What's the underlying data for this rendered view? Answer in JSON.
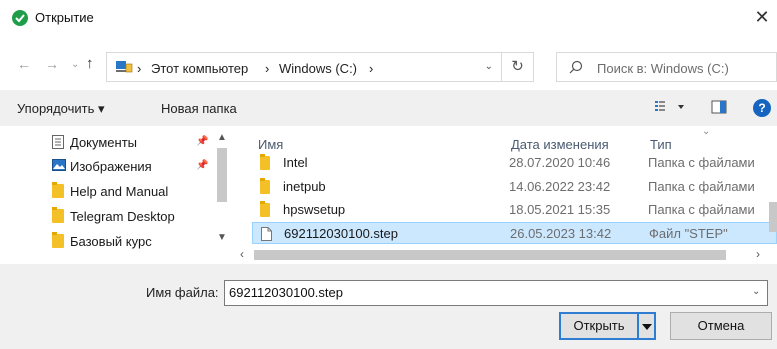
{
  "window": {
    "title": "Открытие",
    "icon": "app-check-icon",
    "close": "✕"
  },
  "address_bar": {
    "segments": [
      "Этот компьютер",
      "Windows (C:)"
    ],
    "separator": "›"
  },
  "search": {
    "placeholder": "Поиск в: Windows (C:)"
  },
  "toolbar": {
    "organize": "Упорядочить ▾",
    "new_folder": "Новая папка",
    "help": "?"
  },
  "nav_pane": {
    "items": [
      {
        "label": "Документы",
        "icon": "documents-icon",
        "pinned": true
      },
      {
        "label": "Изображения",
        "icon": "images-icon",
        "pinned": true
      },
      {
        "label": "Help and Manual",
        "icon": "folder-icon",
        "pinned": false
      },
      {
        "label": "Telegram Desktop",
        "icon": "folder-icon",
        "pinned": false
      },
      {
        "label": "Базовый курс",
        "icon": "folder-icon",
        "pinned": false
      }
    ]
  },
  "file_list": {
    "columns": {
      "name": "Имя",
      "date": "Дата изменения",
      "type": "Тип"
    },
    "rows": [
      {
        "name": "Intel",
        "date": "28.07.2020 10:46",
        "type": "Папка с файлами",
        "kind": "folder",
        "selected": false
      },
      {
        "name": "inetpub",
        "date": "14.06.2022 23:42",
        "type": "Папка с файлами",
        "kind": "folder",
        "selected": false
      },
      {
        "name": "hpswsetup",
        "date": "18.05.2021 15:35",
        "type": "Папка с файлами",
        "kind": "folder",
        "selected": false
      },
      {
        "name": "692112030100.step",
        "date": "26.05.2023 13:42",
        "type": "Файл \"STEP\"",
        "kind": "file",
        "selected": true
      }
    ]
  },
  "footer": {
    "filename_label": "Имя файла:",
    "filename_value": "692112030100.step",
    "open_button": "Открыть",
    "cancel_button": "Отмена"
  },
  "colors": {
    "selection": "#cce8ff",
    "accent": "#2f7dd3",
    "folder": "#f3c027"
  }
}
